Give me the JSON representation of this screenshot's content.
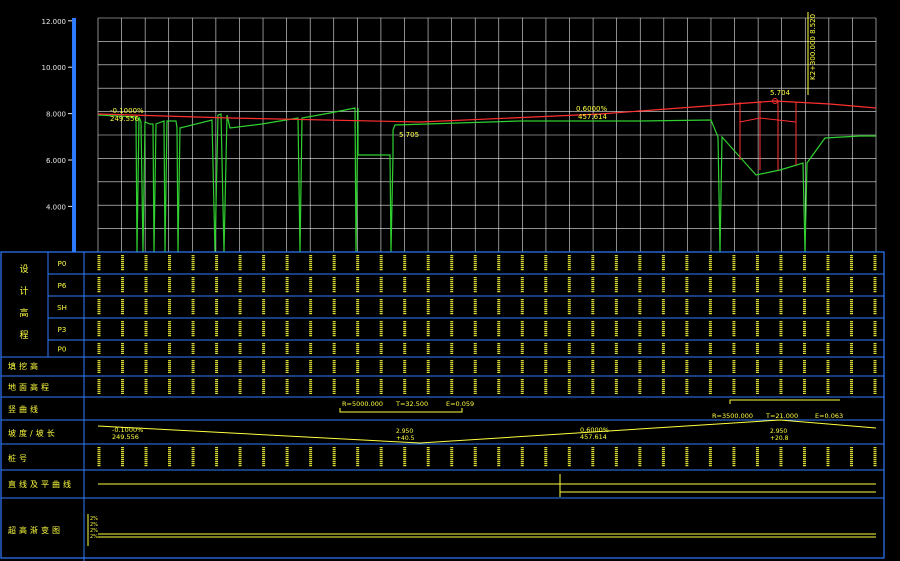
{
  "profile_chart": {
    "y_ticks": [
      {
        "label": "12.000",
        "value": 12
      },
      {
        "label": "10.000",
        "value": 10
      },
      {
        "label": "8.000",
        "value": 8
      },
      {
        "label": "6.000",
        "value": 6
      },
      {
        "label": "4.000",
        "value": 4
      }
    ],
    "annotations": {
      "grade_left": "-0.1000%",
      "grade_left_len": "249.556",
      "grade_mid": "0.6000%",
      "grade_mid_len": "457.614",
      "pvi_label_mid": "5.705",
      "pvi_label_right": "5.704",
      "vertical_tag": "K2+300.000 8.520"
    },
    "colors": {
      "design": "#ff3030",
      "ground": "#30d030",
      "grid": "#e8e8e8",
      "text": "#ffff40",
      "frame": "#2f7bff"
    }
  },
  "table": {
    "group_label": "设计高程",
    "group_chars": [
      "设",
      "计",
      "高",
      "程"
    ],
    "sub_rows": [
      "P0",
      "P6",
      "SH",
      "P3",
      "P0"
    ],
    "rows": [
      {
        "label": "填挖高"
      },
      {
        "label": "地面高程"
      },
      {
        "label": "竖曲线"
      },
      {
        "label": "坡度/坡长"
      },
      {
        "label": "桩号"
      },
      {
        "label": "直线及平曲线"
      },
      {
        "label": "超高渐变图"
      }
    ],
    "vcurve_left": {
      "r": "R=5000.000",
      "t": "T=32.500",
      "e": "E=0.059"
    },
    "vcurve_right": {
      "r": "R=3500.000",
      "t": "T=21.000",
      "e": "E=0.063"
    },
    "grade_left": "-0.1000%",
    "grade_left_len": "249.556",
    "grade_mid_a": "2.950",
    "grade_mid_b": "+40.5",
    "grade_right": "0.6000%",
    "grade_right_len": "457.614",
    "grade_far_a": "2.950",
    "grade_far_b": "+20.8",
    "superelev_labels": [
      "2%",
      "2%",
      "2%",
      "2%"
    ]
  }
}
